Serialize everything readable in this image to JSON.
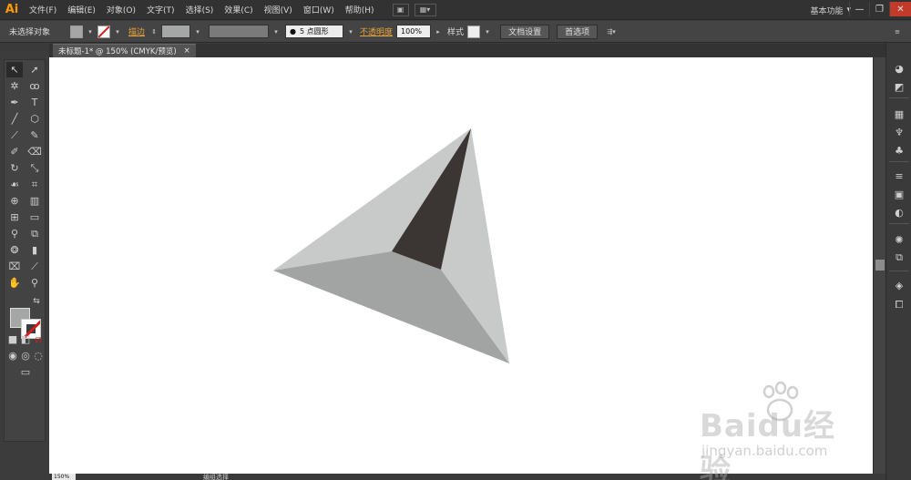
{
  "app": {
    "logo": "Ai"
  },
  "menu": [
    "文件(F)",
    "编辑(E)",
    "对象(O)",
    "文字(T)",
    "选择(S)",
    "效果(C)",
    "视图(V)",
    "窗口(W)",
    "帮助(H)"
  ],
  "workspace": {
    "label": "基本功能"
  },
  "window_controls": {
    "minimize": "—",
    "restore": "❐",
    "close": "✕"
  },
  "control_bar": {
    "selection_state": "未选择对象",
    "stroke_label": "描边",
    "brush_label": "5 点圆形",
    "opacity_label": "不透明度",
    "opacity_value": "100%",
    "style_label": "样式",
    "doc_setup_button": "文档设置",
    "preferences_button": "首选项"
  },
  "document_tab": {
    "title": "未标题-1* @ 150% (CMYK/预览)",
    "close": "×"
  },
  "canvas": {
    "background": "#ffffff",
    "shape_colors": {
      "light_face": "#c8cac9",
      "mid_face": "#a1a4a3",
      "dark_face": "#3b3634"
    }
  },
  "tools": {
    "fill_color": "#a4a7a6",
    "stroke_color": "#d21e1e"
  },
  "status_bar": {
    "zoom": "150%",
    "status_text": "编组选择"
  },
  "watermark": {
    "title": "Baidu经验",
    "url": "jingyan.baidu.com"
  },
  "colors": {
    "menubar": "#323232",
    "controlbar": "#444444",
    "panel": "#3c3c3c",
    "accent": "#e8a33a",
    "logo": "#ff9a00"
  }
}
